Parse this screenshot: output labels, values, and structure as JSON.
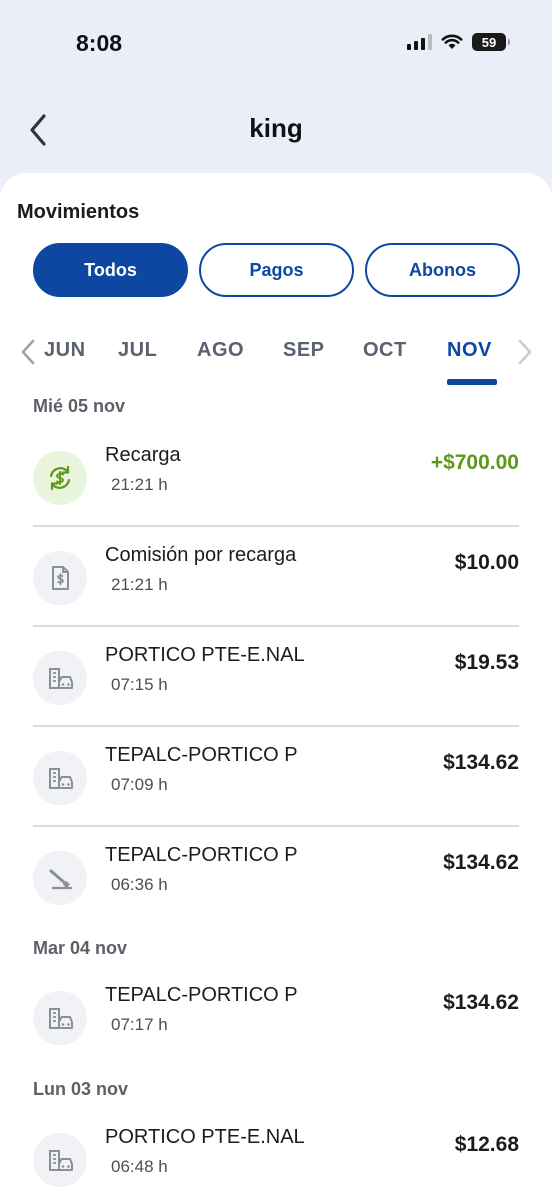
{
  "status_bar": {
    "time": "8:08",
    "battery": "59"
  },
  "header": {
    "title": "king"
  },
  "section": {
    "title": "Movimientos"
  },
  "filters": [
    {
      "label": "Todos",
      "active": true
    },
    {
      "label": "Pagos",
      "active": false
    },
    {
      "label": "Abonos",
      "active": false
    }
  ],
  "months": [
    {
      "label": "JUN",
      "active": false
    },
    {
      "label": "JUL",
      "active": false
    },
    {
      "label": "AGO",
      "active": false
    },
    {
      "label": "SEP",
      "active": false
    },
    {
      "label": "OCT",
      "active": false
    },
    {
      "label": "NOV",
      "active": true
    }
  ],
  "groups": [
    {
      "date": "Mié 05 nov",
      "transactions": [
        {
          "name": "Recarga",
          "time": "21:21 h",
          "amount": "+$700.00",
          "icon": "recharge-icon",
          "positive": true
        },
        {
          "name": "Comisión por recarga",
          "time": "21:21 h",
          "amount": "$10.00",
          "icon": "receipt-icon",
          "positive": false
        },
        {
          "name": "PORTICO PTE-E.NAL",
          "time": "07:15 h",
          "amount": "$19.53",
          "icon": "toll-booth-icon",
          "positive": false
        },
        {
          "name": "TEPALC-PORTICO P",
          "time": "07:09 h",
          "amount": "$134.62",
          "icon": "toll-booth-icon",
          "positive": false
        },
        {
          "name": "TEPALC-PORTICO P",
          "time": "06:36 h",
          "amount": "$134.62",
          "icon": "barrier-gate-icon",
          "positive": false
        }
      ]
    },
    {
      "date": "Mar 04 nov",
      "transactions": [
        {
          "name": "TEPALC-PORTICO P",
          "time": "07:17 h",
          "amount": "$134.62",
          "icon": "toll-booth-icon",
          "positive": false
        }
      ]
    },
    {
      "date": "Lun 03 nov",
      "transactions": [
        {
          "name": "PORTICO PTE-E.NAL",
          "time": "06:48 h",
          "amount": "$12.68",
          "icon": "toll-booth-icon",
          "positive": false
        }
      ]
    }
  ],
  "colors": {
    "primary": "#0d47a1",
    "positive": "#5b9a18",
    "background": "#e9eef8"
  }
}
